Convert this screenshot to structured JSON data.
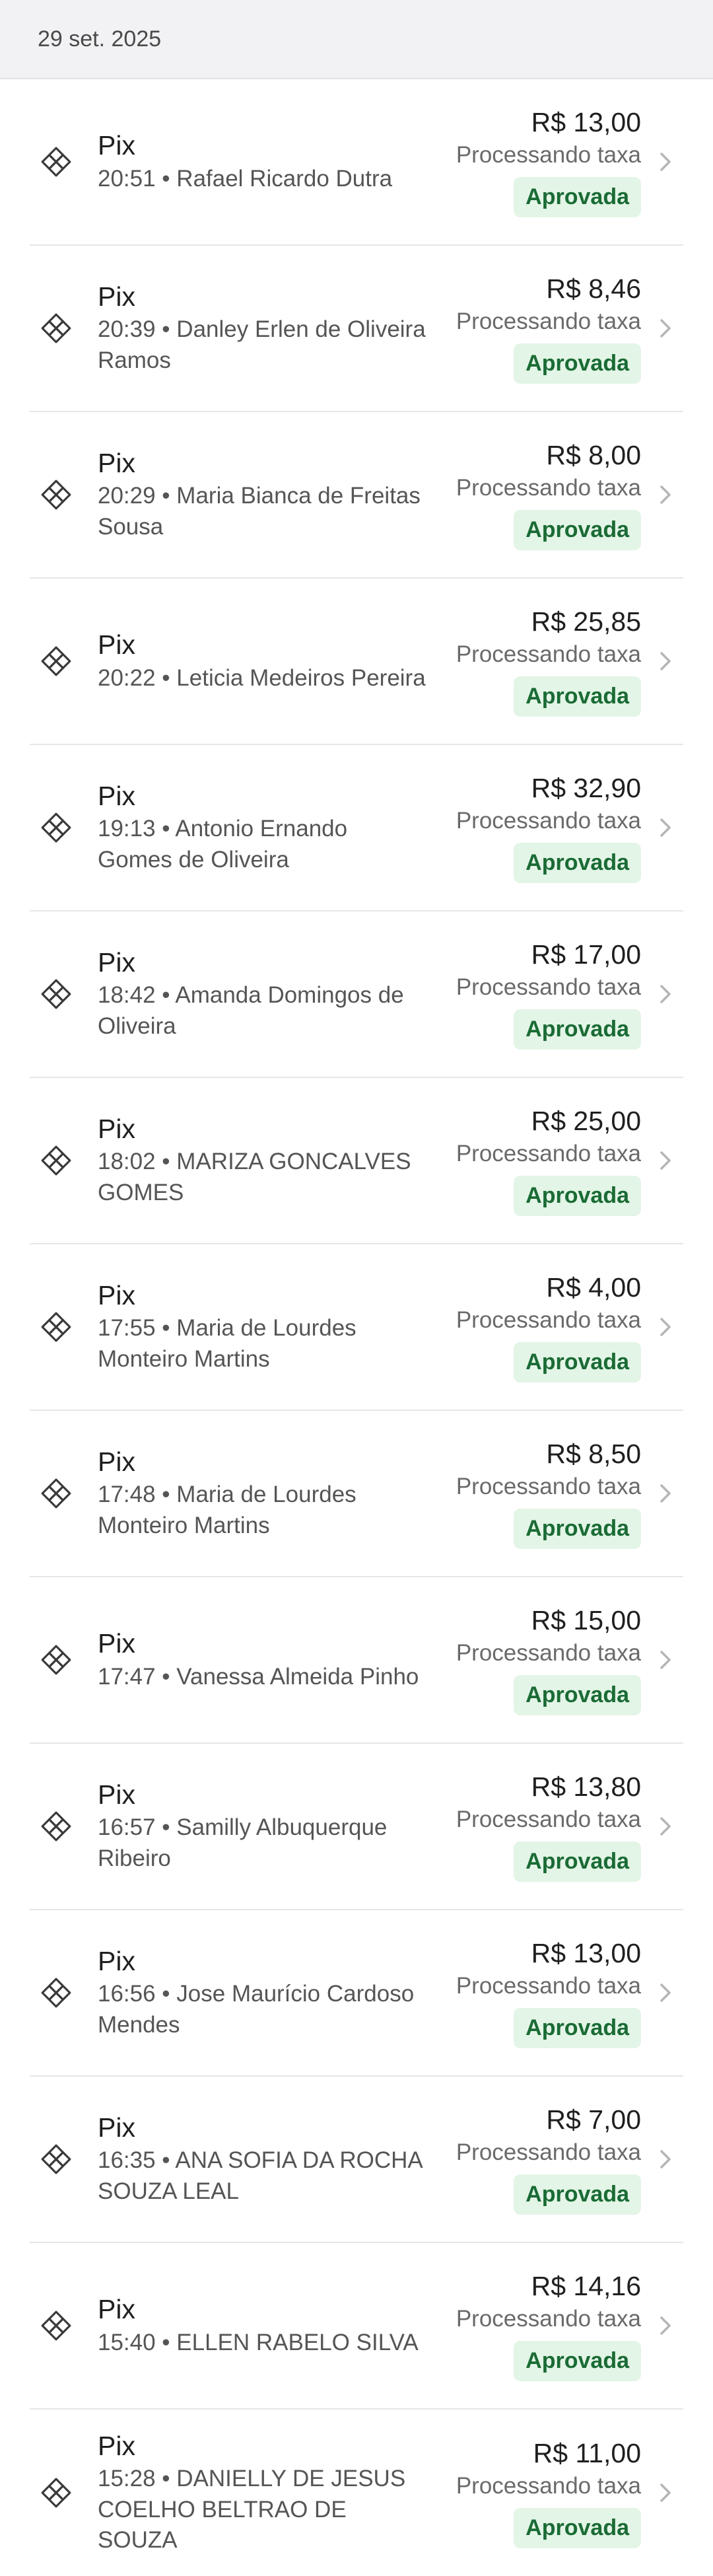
{
  "date_header": "29 set. 2025",
  "transactions": [
    {
      "method": "Pix",
      "detail": "20:51 • Rafael Ricardo Dutra",
      "amount": "R$ 13,00",
      "status_text": "Processando taxa",
      "badge": "Aprovada"
    },
    {
      "method": "Pix",
      "detail": "20:39 • Danley Erlen de Oliveira Ramos",
      "amount": "R$ 8,46",
      "status_text": "Processando taxa",
      "badge": "Aprovada"
    },
    {
      "method": "Pix",
      "detail": "20:29 • Maria Bianca de Freitas Sousa",
      "amount": "R$ 8,00",
      "status_text": "Processando taxa",
      "badge": "Aprovada"
    },
    {
      "method": "Pix",
      "detail": "20:22 • Leticia Medeiros Pereira",
      "amount": "R$ 25,85",
      "status_text": "Processando taxa",
      "badge": "Aprovada"
    },
    {
      "method": "Pix",
      "detail": "19:13 • Antonio Ernando Gomes de Oliveira",
      "amount": "R$ 32,90",
      "status_text": "Processando taxa",
      "badge": "Aprovada"
    },
    {
      "method": "Pix",
      "detail": "18:42 • Amanda Domingos de Oliveira",
      "amount": "R$ 17,00",
      "status_text": "Processando taxa",
      "badge": "Aprovada"
    },
    {
      "method": "Pix",
      "detail": "18:02 • MARIZA GONCALVES GOMES",
      "amount": "R$ 25,00",
      "status_text": "Processando taxa",
      "badge": "Aprovada"
    },
    {
      "method": "Pix",
      "detail": "17:55 • Maria de Lourdes Monteiro Martins",
      "amount": "R$ 4,00",
      "status_text": "Processando taxa",
      "badge": "Aprovada"
    },
    {
      "method": "Pix",
      "detail": "17:48 • Maria de Lourdes Monteiro Martins",
      "amount": "R$ 8,50",
      "status_text": "Processando taxa",
      "badge": "Aprovada"
    },
    {
      "method": "Pix",
      "detail": "17:47 • Vanessa Almeida Pinho",
      "amount": "R$ 15,00",
      "status_text": "Processando taxa",
      "badge": "Aprovada"
    },
    {
      "method": "Pix",
      "detail": "16:57 • Samilly Albuquerque Ribeiro",
      "amount": "R$ 13,80",
      "status_text": "Processando taxa",
      "badge": "Aprovada"
    },
    {
      "method": "Pix",
      "detail": "16:56 • Jose Maurício Cardoso Mendes",
      "amount": "R$ 13,00",
      "status_text": "Processando taxa",
      "badge": "Aprovada"
    },
    {
      "method": "Pix",
      "detail": "16:35 • ANA SOFIA DA ROCHA SOUZA LEAL",
      "amount": "R$ 7,00",
      "status_text": "Processando taxa",
      "badge": "Aprovada"
    },
    {
      "method": "Pix",
      "detail": "15:40 • ELLEN RABELO SILVA",
      "amount": "R$ 14,16",
      "status_text": "Processando taxa",
      "badge": "Aprovada"
    },
    {
      "method": "Pix",
      "detail": "15:28 • DANIELLY DE JESUS COELHO BELTRAO DE SOUZA",
      "amount": "R$ 11,00",
      "status_text": "Processando taxa",
      "badge": "Aprovada"
    }
  ],
  "icons": {
    "payment_method": "pix-icon",
    "row_action": "chevron-right-icon"
  },
  "colors": {
    "badge_background": "#e3f5e6",
    "badge_text": "#1a6b35",
    "header_background": "#f2f2f4"
  }
}
